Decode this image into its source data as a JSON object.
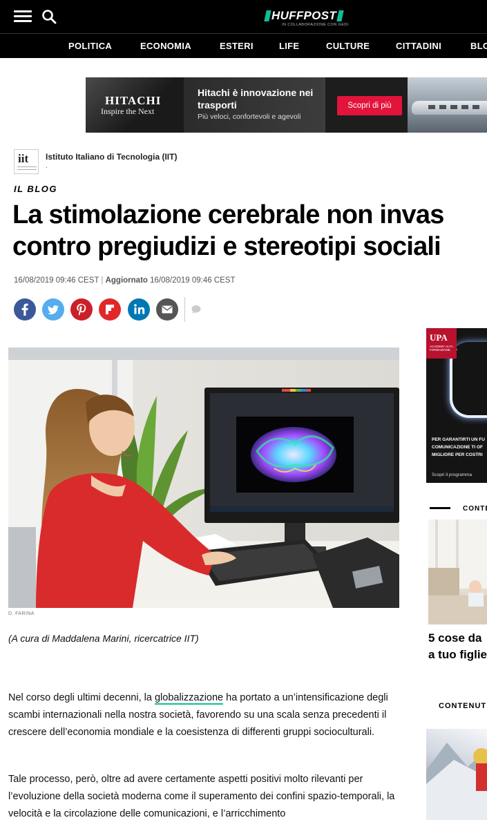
{
  "header": {
    "logo_text": "HUFFPOST",
    "logo_subtitle": "IN COLLABORAZIONE CON GEDI"
  },
  "nav": {
    "items": [
      "POLITICA",
      "ECONOMIA",
      "ESTERI",
      "LIFE",
      "CULTURE",
      "CITTADINI",
      "BLO"
    ]
  },
  "ad_banner": {
    "brand": "HITACHI",
    "brand_tagline": "Inspire the Next",
    "headline": "Hitachi è innovazione nei trasporti",
    "subline": "Più veloci, confortevoli e agevoli",
    "cta": "Scopri di più",
    "cta_color": "#e3143b"
  },
  "author": {
    "logo_text": "iit",
    "name": "Istituto Italiano di Tecnologia (IIT)",
    "dot": "."
  },
  "article": {
    "kicker": "IL BLOG",
    "headline_line1": "La stimolazione cerebrale non invas",
    "headline_line2": "contro pregiudizi e stereotipi sociali",
    "published": "16/08/2019 09:46 CEST",
    "separator": "|",
    "updated_label": "Aggiornato",
    "updated": "16/08/2019 09:46 CEST",
    "photo_credit": "D. FARINA",
    "caption": "(A cura di Maddalena Marini, ricercatrice IIT)",
    "p1_before": "Nel corso degli ultimi decenni, la ",
    "p1_link": "globalizzazione",
    "p1_after": " ha portato a un’intensificazione degli scambi internazionali nella nostra società, favorendo su una scala senza precedenti il crescere dell’economia mondiale e la coesistenza di differenti gruppi socioculturali.",
    "p2": "Tale processo, però, oltre ad avere certamente aspetti positivi molto rilevanti per l’evoluzione della società moderna come il superamento dei confini spazio-temporali, la velocità e la circolazione delle comunicazioni, e l’arricchimento"
  },
  "share": {
    "buttons": [
      {
        "name": "facebook",
        "glyph": "f",
        "color": "#3b5998"
      },
      {
        "name": "twitter",
        "glyph": "t",
        "color": "#55acee"
      },
      {
        "name": "pinterest",
        "glyph": "p",
        "color": "#cb2027"
      },
      {
        "name": "flipboard",
        "glyph": "F",
        "color": "#e12828"
      },
      {
        "name": "linkedin",
        "glyph": "in",
        "color": "#0077b5"
      },
      {
        "name": "email",
        "glyph": "mail",
        "color": "#555555"
      }
    ]
  },
  "sidebar": {
    "ad_brand": "UPA",
    "ad_brand_sub": "ACADEMY ALTA FORMAZIONE",
    "ad_line1": "PER GARANTIRTI UN FU",
    "ad_line2": "COMUNICAZIONE TI OF",
    "ad_line3": "MIGLIORE PER COSTRI",
    "ad_cta": "Scopri il programma",
    "section1_label": "CONTE",
    "story1_line1": "5 cose da",
    "story1_line2": "a tuo figlie",
    "section2_label": "CONTENUT"
  },
  "colors": {
    "accent": "#0dbe98",
    "nav_bg": "#000000"
  }
}
